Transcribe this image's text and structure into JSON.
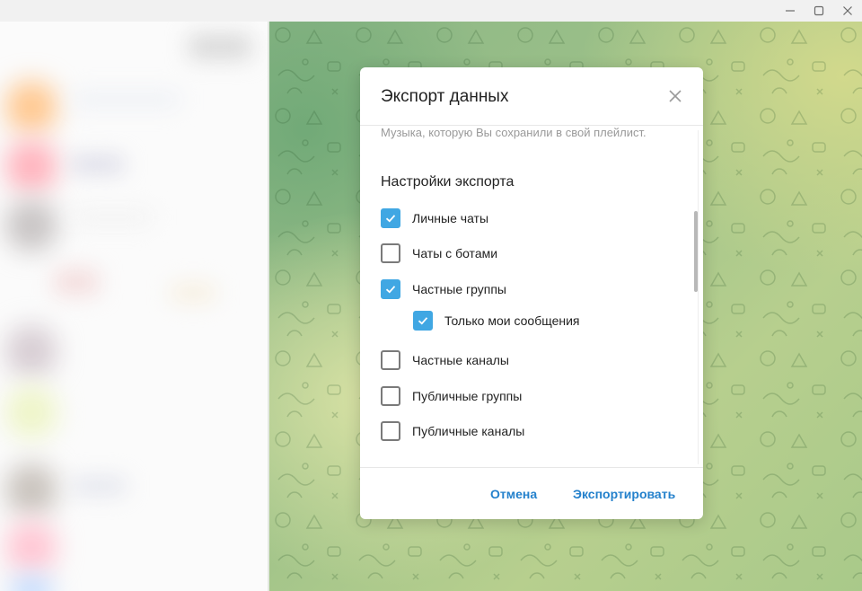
{
  "window": {
    "controls": [
      "minimize-icon",
      "maximize-icon",
      "close-icon"
    ]
  },
  "dialog": {
    "title": "Экспорт данных",
    "music_description": "Музыка, которую Вы сохранили в свой плейлист.",
    "settings_title": "Настройки экспорта",
    "options": [
      {
        "label": "Личные чаты",
        "checked": true
      },
      {
        "label": "Чаты с ботами",
        "checked": false
      },
      {
        "label": "Частные группы",
        "checked": true
      },
      {
        "label": "Только мои сообщения",
        "checked": true
      },
      {
        "label": "Частные каналы",
        "checked": false
      },
      {
        "label": "Публичные группы",
        "checked": false
      },
      {
        "label": "Публичные каналы",
        "checked": false
      }
    ],
    "cancel_label": "Отмена",
    "export_label": "Экспортировать"
  },
  "colors": {
    "accent": "#40a7e3",
    "link": "#2481cc"
  }
}
